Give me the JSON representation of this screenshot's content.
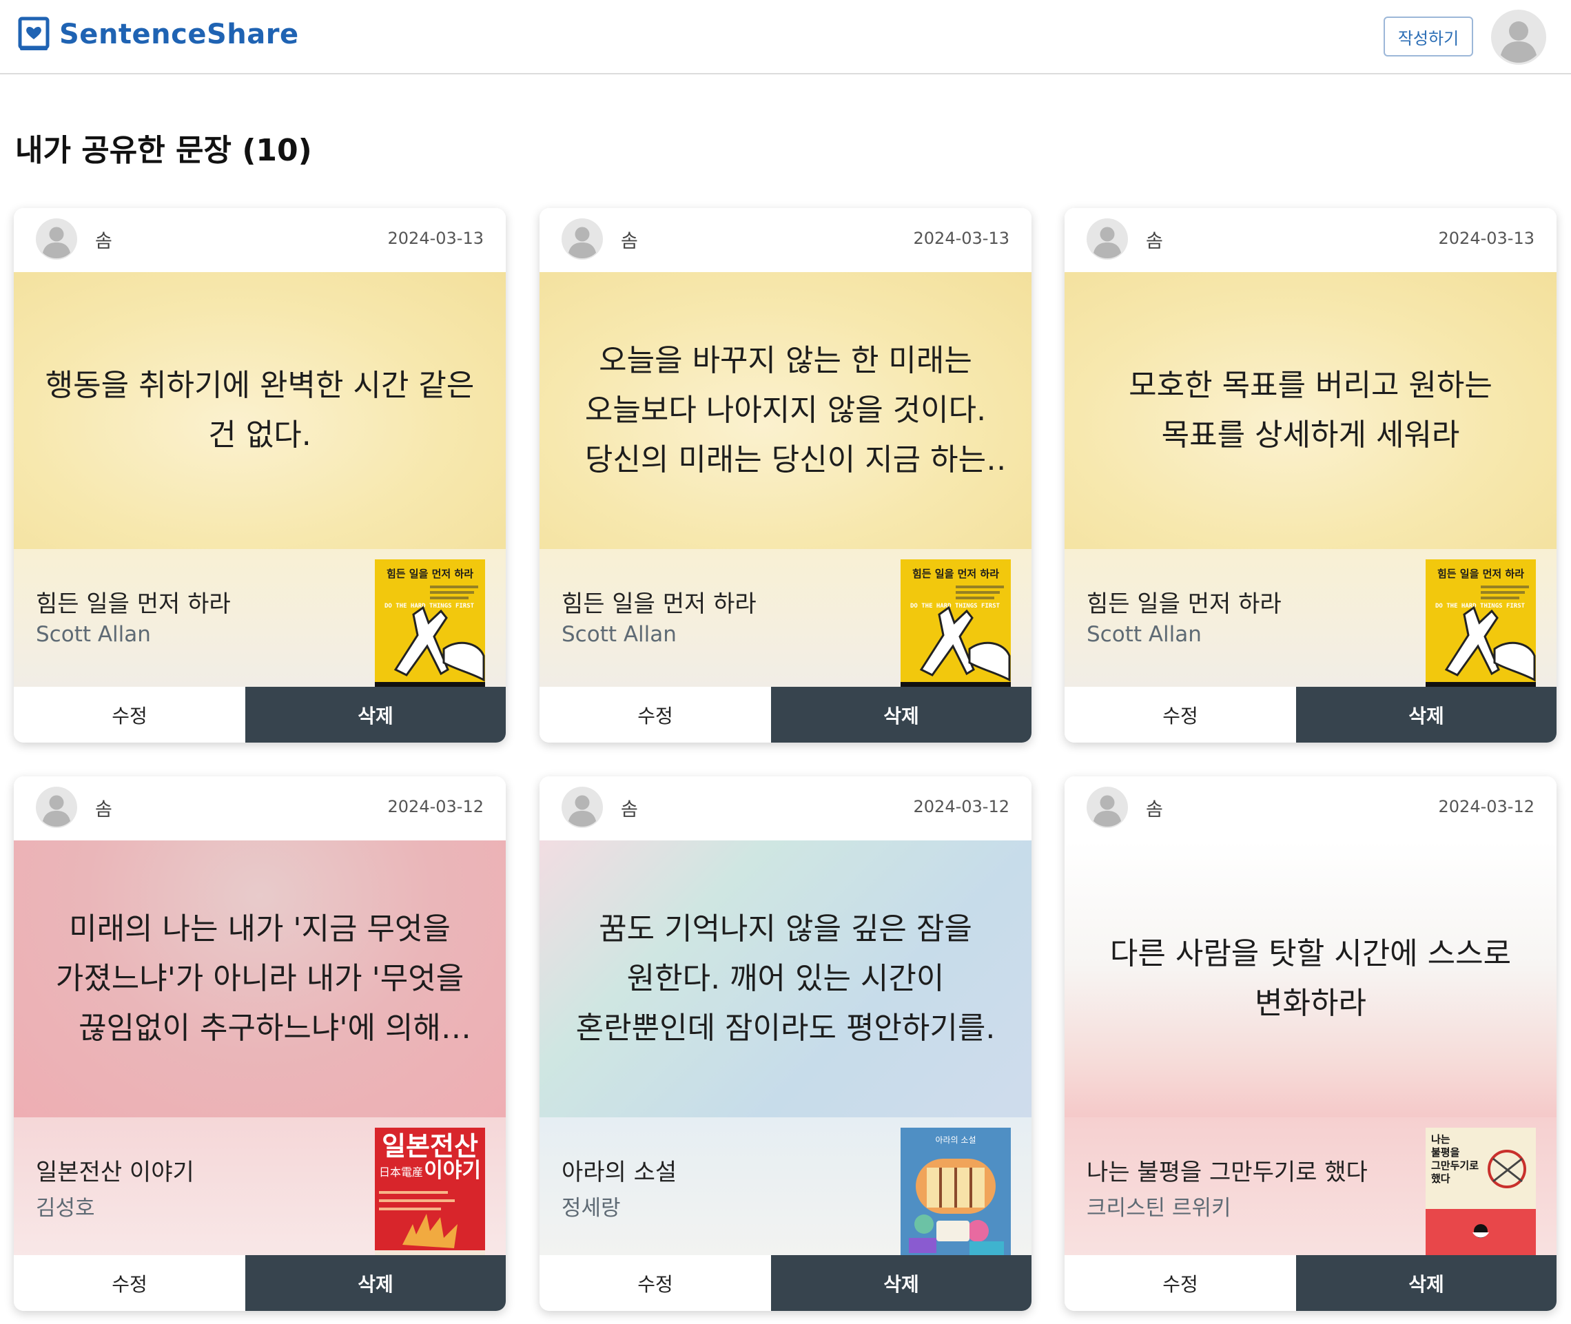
{
  "header": {
    "logo_text": "SentenceShare",
    "write_button": "작성하기",
    "logo_icon": "heart-book-icon",
    "avatar_icon": "user-avatar-icon",
    "brand_color": "#1f63b3"
  },
  "page": {
    "title": "내가 공유한 문장 (10)"
  },
  "actions": {
    "edit": "수정",
    "delete": "삭제"
  },
  "cards": [
    {
      "user": "솜",
      "date": "2024-03-13",
      "quote": "행동을 취하기에 완벽한 시간 같은 건 없다.",
      "book_title": "힘든 일을 먼저 하라",
      "book_author": "Scott Allan",
      "cover_title": "힘든 일을 먼저 하라",
      "cover_sub": "DO THE HARD THINGS FIRST"
    },
    {
      "user": "솜",
      "date": "2024-03-13",
      "quote": "오늘을 바꾸지 않는 한 미래는 오늘보다 나아지지 않을 것이다. 당신의 미래는 당신이 지금 하는 일을...",
      "book_title": "힘든 일을 먼저 하라",
      "book_author": "Scott Allan",
      "cover_title": "힘든 일을 먼저 하라",
      "cover_sub": "DO THE HARD THINGS FIRST"
    },
    {
      "user": "솜",
      "date": "2024-03-13",
      "quote": "모호한 목표를 버리고 원하는 목표를 상세하게 세워라",
      "book_title": "힘든 일을 먼저 하라",
      "book_author": "Scott Allan",
      "cover_title": "힘든 일을 먼저 하라",
      "cover_sub": "DO THE HARD THINGS FIRST"
    },
    {
      "user": "솜",
      "date": "2024-03-12",
      "quote": "미래의 나는 내가 '지금 무엇을 가졌느냐'가 아니라 내가 '무엇을 끊임없이 추구하느냐'에 의해 좌우...",
      "book_title": "일본전산 이야기",
      "book_author": "김성호",
      "cover_title": "일본전산",
      "cover_sub": "이야기",
      "cover_kanji": "日本電産"
    },
    {
      "user": "솜",
      "date": "2024-03-12",
      "quote": "꿈도 기억나지 않을 깊은 잠을 원한다. 깨어 있는 시간이 혼란뿐인데 잠이라도 평안하기를.",
      "book_title": "아라의 소설",
      "book_author": "정세랑",
      "cover_title": "아라의 소설"
    },
    {
      "user": "솜",
      "date": "2024-03-12",
      "quote": "다른 사람을 탓할 시간에 스스로 변화하라",
      "book_title": "나는 불평을 그만두기로 했다",
      "book_author": "크리스틴 르위키",
      "cover_title": "나는 불평을 그만두기로 했다"
    }
  ]
}
